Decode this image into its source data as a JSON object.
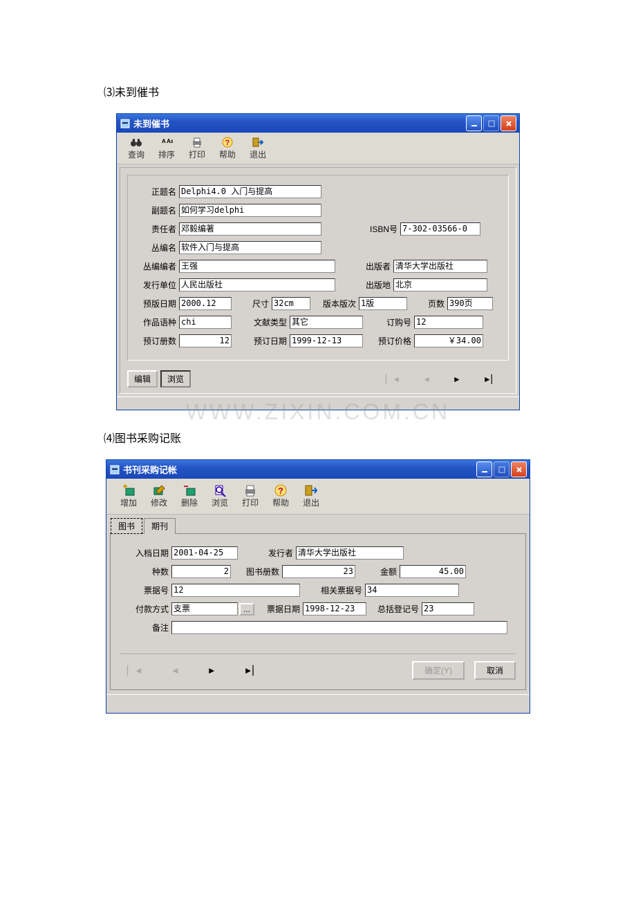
{
  "captions": {
    "c3": "⑶未到催书",
    "c4": "⑷图书采购记账"
  },
  "watermark": "WWW.ZIXIN.COM.CN",
  "win1": {
    "title": "未到催书",
    "toolbar": [
      {
        "label": "查询",
        "name": "search"
      },
      {
        "label": "排序",
        "name": "sort"
      },
      {
        "label": "打印",
        "name": "print"
      },
      {
        "label": "帮助",
        "name": "help"
      },
      {
        "label": "退出",
        "name": "exit"
      }
    ],
    "fields": {
      "zhenming_lbl": "正题名",
      "zhenming": "Delphi4.0 入门与提高",
      "futiming_lbl": "副题名",
      "futiming": "如何学习delphi",
      "zerenzhe_lbl": "责任者",
      "zerenzhe": "邓毅编著",
      "isbn_lbl": "ISBN号",
      "isbn": "7-302-03566-0",
      "congbianming_lbl": "丛编名",
      "congbianming": "软件入门与提高",
      "congbianbianzhe_lbl": "丛编编者",
      "congbianbianzhe": "王强",
      "chubanze_lbl": "出版者",
      "chubanze": "清华大学出版社",
      "faxingdw_lbl": "发行单位",
      "faxingdw": "人民出版社",
      "chubandi_lbl": "出版地",
      "chubandi": "北京",
      "yubandate_lbl": "预版日期",
      "yubandate": "2000.12",
      "chicun_lbl": "尺寸",
      "chicun": "32cm",
      "banbenbanci_lbl": "版本版次",
      "banbenbanci": "1版",
      "yeshu_lbl": "页数",
      "yeshu": "390页",
      "zuopinyuzhong_lbl": "作品语种",
      "zuopinyuzhong": "chi",
      "wenxianleixing_lbl": "文献类型",
      "wenxianleixing": "其它",
      "dinggouhao_lbl": "订购号",
      "dinggouhao": "12",
      "yudingces_lbl": "预订册数",
      "yudingces": "12",
      "yudingriqi_lbl": "预订日期",
      "yudingriqi": "1999-12-13",
      "yudingjiage_lbl": "预订价格",
      "yudingjiage": "￥34.00"
    },
    "btns": {
      "edit": "编辑",
      "browse": "浏览"
    }
  },
  "win2": {
    "title": "书刊采购记帐",
    "toolbar": [
      {
        "label": "增加",
        "name": "add"
      },
      {
        "label": "修改",
        "name": "edit"
      },
      {
        "label": "删除",
        "name": "delete"
      },
      {
        "label": "浏览",
        "name": "browse"
      },
      {
        "label": "打印",
        "name": "print"
      },
      {
        "label": "帮助",
        "name": "help"
      },
      {
        "label": "退出",
        "name": "exit"
      }
    ],
    "tabs": {
      "tushu": "图书",
      "qikan": "期刊"
    },
    "fields": {
      "rudang_lbl": "入档日期",
      "rudang": "2001-04-25",
      "faxingzhe_lbl": "发行者",
      "faxingzhe": "清华大学出版社",
      "zhongshu_lbl": "种数",
      "zhongshu": "2",
      "tushuceshu_lbl": "图书册数",
      "tushuceshu": "23",
      "jine_lbl": "金额",
      "jine": "45.00",
      "piaojuhao_lbl": "票据号",
      "piaojuhao": "12",
      "xiangguanpjh_lbl": "相关票据号",
      "xiangguanpjh": "34",
      "fukuanfs_lbl": "付款方式",
      "fukuanfs": "支票",
      "piaojurq_lbl": "票据日期",
      "piaojurq": "1998-12-23",
      "zongkuodj_lbl": "总括登记号",
      "zongkuodj": "23",
      "beizhu_lbl": "备注",
      "beizhu": ""
    },
    "btns": {
      "ok": "确定(Y)",
      "cancel": "取消",
      "more": "..."
    }
  }
}
